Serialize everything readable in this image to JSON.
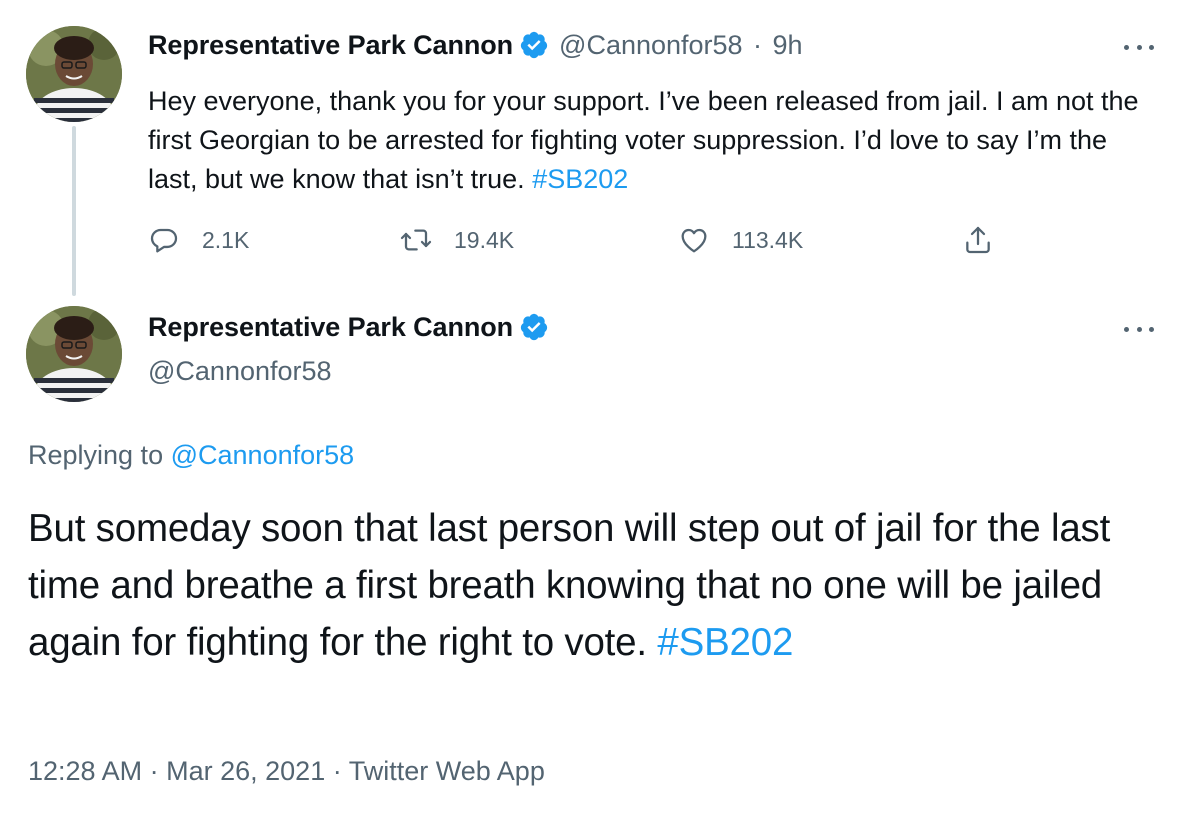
{
  "thread": {
    "first_tweet": {
      "author": "Representative Park Cannon",
      "handle": "@Cannonfor58",
      "separator": "·",
      "age": "9h",
      "text": "Hey everyone, thank you for your support. I’ve been released from jail. I am not the first Georgian to be arrested for fighting voter suppression. I’d love to say I’m the last, but we know that isn’t true.",
      "hashtag": "#SB202",
      "stats": {
        "replies": "2.1K",
        "retweets": "19.4K",
        "likes": "113.4K"
      }
    },
    "focused_tweet": {
      "author": "Representative Park Cannon",
      "handle": "@Cannonfor58",
      "replying_prefix": "Replying to",
      "replying_to": "@Cannonfor58",
      "text": "But someday soon that last person will step out of jail for the last time and breathe a first breath knowing that no one will be jailed again for fighting for the right to vote.",
      "hashtag": "#SB202",
      "time": "12:28 AM",
      "dot": "·",
      "date": "Mar 26, 2021",
      "source": "Twitter Web App"
    }
  },
  "icons": {
    "verified": "verified-badge-icon",
    "more": "more-options-icon",
    "reply": "reply-icon",
    "retweet": "retweet-icon",
    "like": "heart-icon",
    "share": "share-icon"
  },
  "colors": {
    "accent": "#1d9bf0",
    "secondary_text": "#536471",
    "primary_text": "#0f1419",
    "thread_line": "#cfd9de"
  }
}
